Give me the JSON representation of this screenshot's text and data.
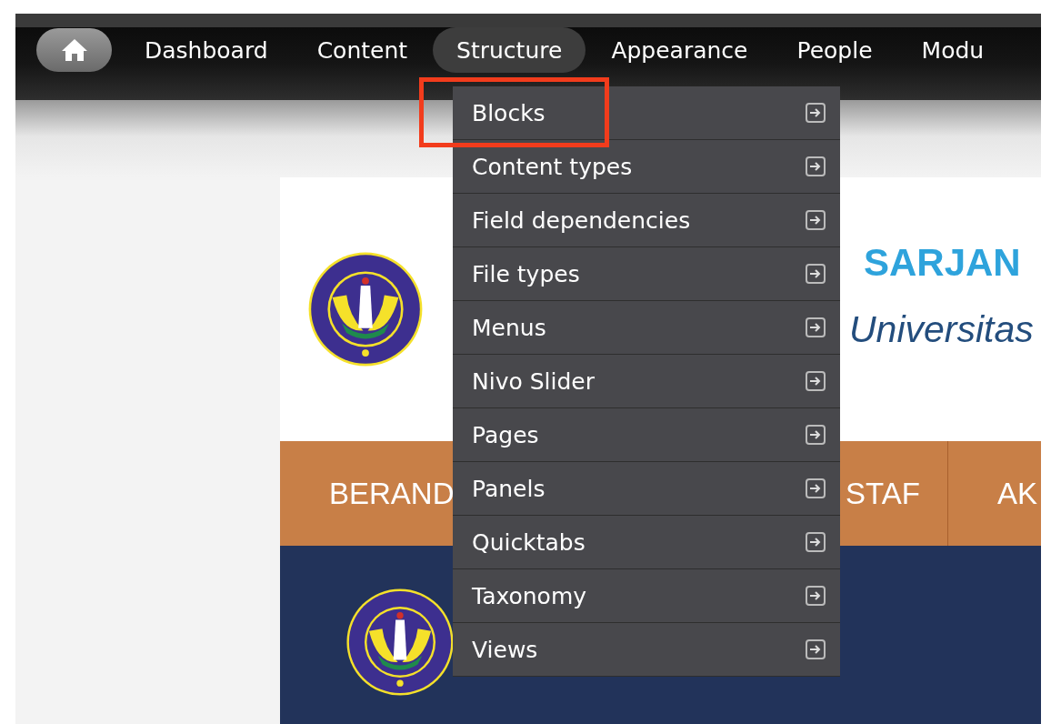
{
  "toolbar": {
    "items": [
      {
        "label": "Dashboard",
        "selected": false
      },
      {
        "label": "Content",
        "selected": false
      },
      {
        "label": "Structure",
        "selected": true
      },
      {
        "label": "Appearance",
        "selected": false
      },
      {
        "label": "People",
        "selected": false
      },
      {
        "label": "Modu",
        "selected": false
      }
    ]
  },
  "dropdown": {
    "items": [
      {
        "label": "Blocks",
        "highlighted": true
      },
      {
        "label": "Content types",
        "highlighted": false
      },
      {
        "label": "Field dependencies",
        "highlighted": false
      },
      {
        "label": "File types",
        "highlighted": false
      },
      {
        "label": "Menus",
        "highlighted": false
      },
      {
        "label": "Nivo Slider",
        "highlighted": false
      },
      {
        "label": "Pages",
        "highlighted": false
      },
      {
        "label": "Panels",
        "highlighted": false
      },
      {
        "label": "Quicktabs",
        "highlighted": false
      },
      {
        "label": "Taxonomy",
        "highlighted": false
      },
      {
        "label": "Views",
        "highlighted": false
      }
    ]
  },
  "site": {
    "title": "SARJAN",
    "subtitle": "Universitas",
    "nav": [
      {
        "label": "BERAND"
      },
      {
        "label": "STAF"
      },
      {
        "label": "AK"
      }
    ]
  }
}
